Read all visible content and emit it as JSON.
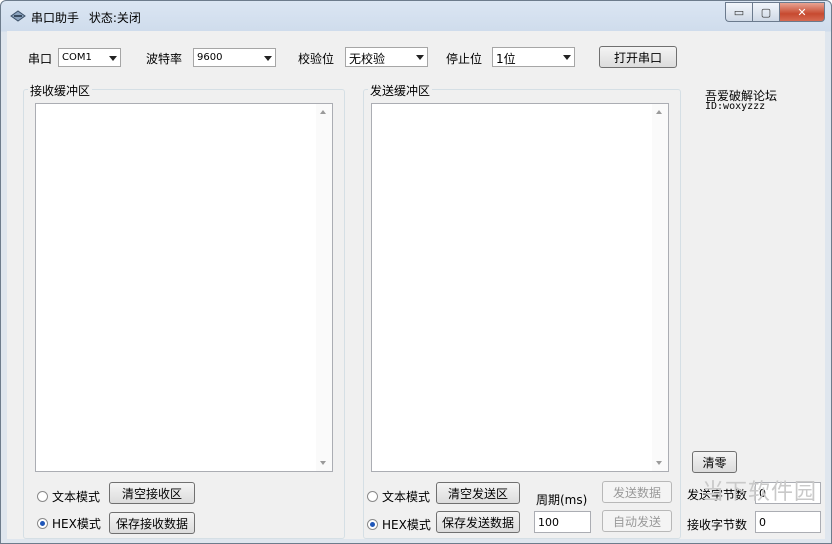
{
  "window": {
    "title": "串口助手",
    "status": "状态:关闭",
    "controls": {
      "minimize": "▭",
      "maximize": "▢",
      "close": "✕"
    }
  },
  "top_bar": {
    "port_label": "串口",
    "port_value": "COM1",
    "baud_label": "波特率",
    "baud_value": "9600",
    "parity_label": "校验位",
    "parity_value": "无校验",
    "stop_label": "停止位",
    "stop_value": "1位",
    "open_button": "打开串口"
  },
  "receive": {
    "title": "接收缓冲区",
    "text_mode": "文本模式",
    "hex_mode": "HEX模式",
    "selected_mode": "HEX模式",
    "clear_button": "清空接收区",
    "save_button": "保存接收数据"
  },
  "send": {
    "title": "发送缓冲区",
    "text_mode": "文本模式",
    "hex_mode": "HEX模式",
    "selected_mode": "HEX模式",
    "clear_button": "清空发送区",
    "save_button": "保存发送数据",
    "period_label": "周期(ms)",
    "period_value": "100",
    "send_button": "发送数据",
    "auto_send_button": "自动发送"
  },
  "stats": {
    "brand": "吾爱破解论坛",
    "id": "ID:woxyzzz",
    "reset_button": "清零",
    "sent_label": "发送字节数",
    "sent_value": "0",
    "recv_label": "接收字节数",
    "recv_value": "0"
  },
  "watermark": "当下软件园",
  "colors": {
    "title_grad_top": "#dbe6f3",
    "close_red": "#c74a30",
    "radio_blue": "#1f56b8"
  }
}
